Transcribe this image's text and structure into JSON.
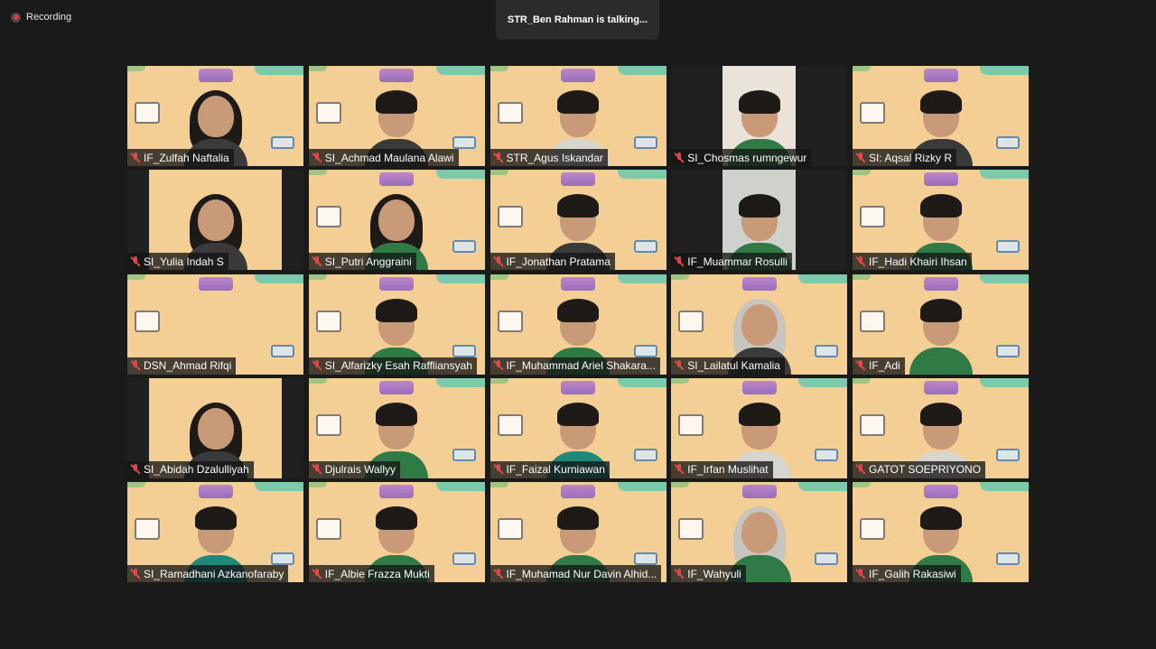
{
  "recording": {
    "label": "Recording"
  },
  "banner": {
    "talking_text": "STR_Ben Rahman is talking..."
  },
  "colors": {
    "page_bg": "#1a1a1a",
    "virtual_bg": "#f3cf95",
    "muted_mic": "#e04848"
  },
  "participants": [
    {
      "name": "IF_Zulfah Naftalia",
      "muted": true
    },
    {
      "name": "SI_Achmad Maulana Alawi",
      "muted": true
    },
    {
      "name": "STR_Agus Iskandar",
      "muted": true
    },
    {
      "name": "SI_Chosmas rumngewur",
      "muted": true
    },
    {
      "name": "SI: Aqsal Rizky R",
      "muted": true
    },
    {
      "name": "SI_Yulia Indah S",
      "muted": true
    },
    {
      "name": "SI_Putri Anggraini",
      "muted": true
    },
    {
      "name": "IF_Jonathan Pratama",
      "muted": true
    },
    {
      "name": "IF_Muammar Rosulli",
      "muted": true
    },
    {
      "name": "IF_Hadi Khairi Ihsan",
      "muted": true
    },
    {
      "name": "DSN_Ahmad Rifqi",
      "muted": true
    },
    {
      "name": "SI_Alfarizky Esah Raffliansyah",
      "muted": true
    },
    {
      "name": "IF_Muhammad Ariel Shakara...",
      "muted": true
    },
    {
      "name": "SI_Lailatul Kamalia",
      "muted": true
    },
    {
      "name": "IF_Adi",
      "muted": true
    },
    {
      "name": "SI_Abidah Dzalulliyah",
      "muted": true
    },
    {
      "name": "Djulrais Wallyy",
      "muted": true
    },
    {
      "name": "IF_Faizal Kurniawan",
      "muted": true
    },
    {
      "name": "IF_Irfan Muslihat",
      "muted": true
    },
    {
      "name": "GATOT SOEPRIYONO",
      "muted": true
    },
    {
      "name": "SI_Ramadhani Azkanofaraby",
      "muted": true
    },
    {
      "name": "IF_Albie Frazza Mukti",
      "muted": true
    },
    {
      "name": "IF_Muhamad Nur Davin Alhid...",
      "muted": true
    },
    {
      "name": "IF_Wahyuli",
      "muted": true
    },
    {
      "name": "IF_Galih Rakasiwi",
      "muted": true
    }
  ]
}
